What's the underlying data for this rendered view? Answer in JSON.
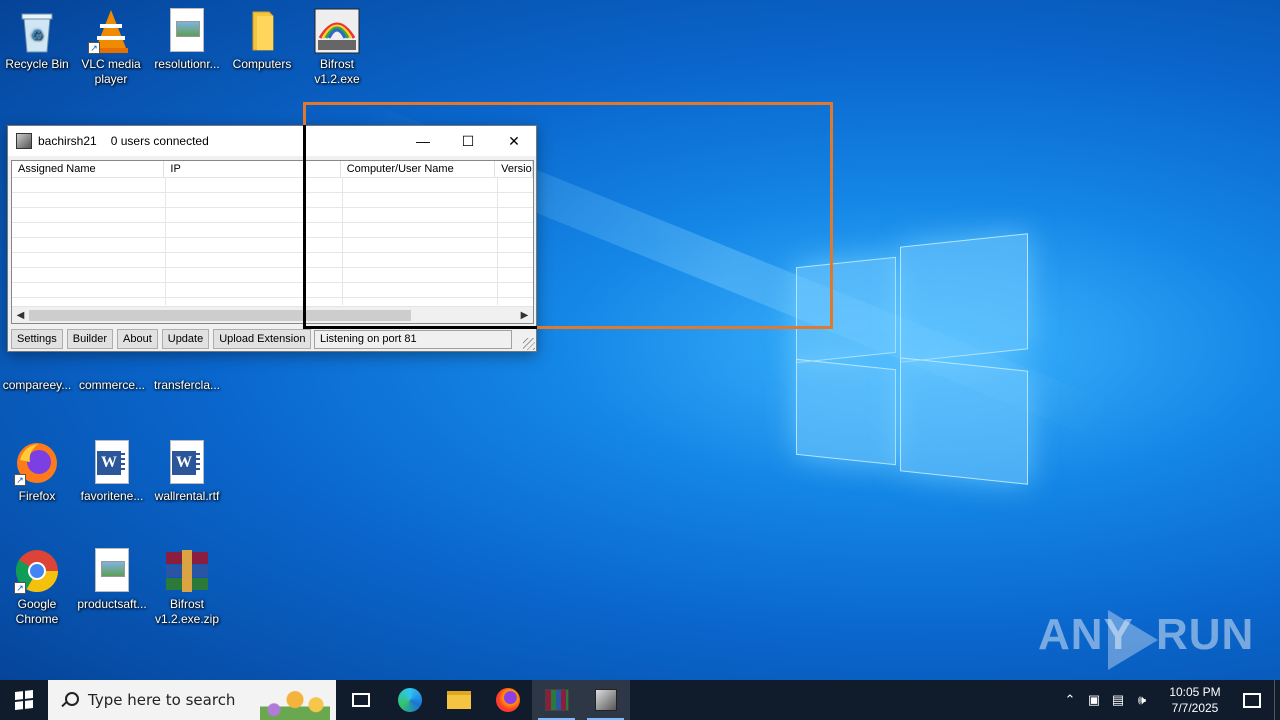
{
  "desktop": {
    "icons": [
      {
        "label": "Recycle Bin",
        "icon": "recycle-bin-icon"
      },
      {
        "label": "VLC media player",
        "icon": "vlc-icon"
      },
      {
        "label": "resolutionr...",
        "icon": "image-file-icon"
      },
      {
        "label": "Computers",
        "icon": "folder-icon"
      },
      {
        "label": "Bifrost v1.2.exe",
        "icon": "bifrost-exe-icon"
      },
      {
        "label": "compareey...",
        "icon": "image-file-icon"
      },
      {
        "label": "commerce...",
        "icon": "word-doc-icon"
      },
      {
        "label": "transfercla...",
        "icon": "word-doc-icon"
      },
      {
        "label": "Firefox",
        "icon": "firefox-icon"
      },
      {
        "label": "favoritene...",
        "icon": "word-doc-icon"
      },
      {
        "label": "wallrental.rtf",
        "icon": "word-doc-icon"
      },
      {
        "label": "Google Chrome",
        "icon": "chrome-icon"
      },
      {
        "label": "productsaft...",
        "icon": "image-file-icon"
      },
      {
        "label": "Bifrost v1.2.exe.zip",
        "icon": "winrar-archive-icon"
      }
    ]
  },
  "window": {
    "title": "bachirsh21",
    "users_status": "0 users connected",
    "columns": [
      "Assigned Name",
      "IP",
      "",
      "Computer/User Name",
      "Versio"
    ],
    "buttons": {
      "settings": "Settings",
      "builder": "Builder",
      "about": "About",
      "update": "Update",
      "upload_extension": "Upload Extension"
    },
    "status": "Listening on port 81",
    "controls": {
      "minimize": "—",
      "maximize": "☐",
      "close": "✕"
    }
  },
  "taskbar": {
    "search_placeholder": "Type here to search",
    "time": "10:05 PM",
    "date": "7/7/2025",
    "apps": [
      "task-view-icon",
      "edge-icon",
      "file-explorer-icon",
      "firefox-icon",
      "winrar-icon",
      "bifrost-icon"
    ],
    "tray": [
      "chevron-up-icon",
      "meet-now-icon",
      "network-icon",
      "volume-icon"
    ]
  },
  "watermark": {
    "text_left": "ANY",
    "text_right": "RUN"
  },
  "colors": {
    "highlight": "#e0782e",
    "taskbar": "#101c2c"
  }
}
